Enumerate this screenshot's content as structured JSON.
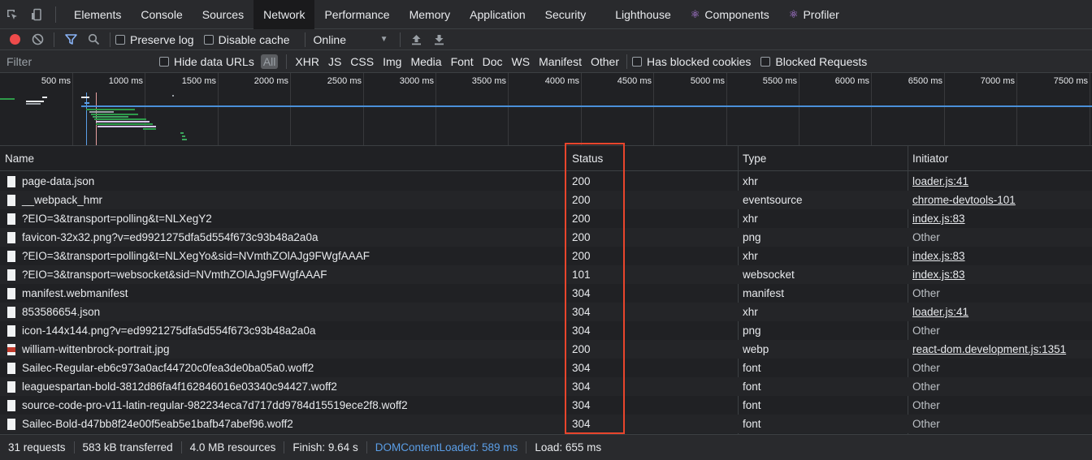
{
  "tabs": [
    "Elements",
    "Console",
    "Sources",
    "Network",
    "Performance",
    "Memory",
    "Application",
    "Security",
    "Lighthouse",
    "Components",
    "Profiler"
  ],
  "toolbar": {
    "preserve_log": "Preserve log",
    "disable_cache": "Disable cache",
    "throttling": "Online"
  },
  "filter": {
    "placeholder": "Filter",
    "hide_data_urls": "Hide data URLs",
    "types": [
      "All",
      "XHR",
      "JS",
      "CSS",
      "Img",
      "Media",
      "Font",
      "Doc",
      "WS",
      "Manifest",
      "Other"
    ],
    "has_blocked_cookies": "Has blocked cookies",
    "blocked_requests": "Blocked Requests"
  },
  "overview": {
    "ticks": [
      "500 ms",
      "1000 ms",
      "1500 ms",
      "2000 ms",
      "2500 ms",
      "3000 ms",
      "3500 ms",
      "4000 ms",
      "4500 ms",
      "5000 ms",
      "5500 ms",
      "6000 ms",
      "6500 ms",
      "7000 ms",
      "7500 ms"
    ]
  },
  "columns": {
    "name": "Name",
    "status": "Status",
    "type": "Type",
    "initiator": "Initiator"
  },
  "requests": [
    {
      "name": "page-data.json",
      "status": "200",
      "type": "xhr",
      "initiator": "loader.js:41",
      "initiator_link": true,
      "icon": "file"
    },
    {
      "name": "__webpack_hmr",
      "status": "200",
      "type": "eventsource",
      "initiator": "chrome-devtools-101",
      "initiator_link": true,
      "icon": "file"
    },
    {
      "name": "?EIO=3&transport=polling&t=NLXegY2",
      "status": "200",
      "type": "xhr",
      "initiator": "index.js:83",
      "initiator_link": true,
      "icon": "file"
    },
    {
      "name": "favicon-32x32.png?v=ed9921275dfa5d554f673c93b48a2a0a",
      "status": "200",
      "type": "png",
      "initiator": "Other",
      "initiator_link": false,
      "icon": "file"
    },
    {
      "name": "?EIO=3&transport=polling&t=NLXegYo&sid=NVmthZOlAJg9FWgfAAAF",
      "status": "200",
      "type": "xhr",
      "initiator": "index.js:83",
      "initiator_link": true,
      "icon": "file"
    },
    {
      "name": "?EIO=3&transport=websocket&sid=NVmthZOlAJg9FWgfAAAF",
      "status": "101",
      "type": "websocket",
      "initiator": "index.js:83",
      "initiator_link": true,
      "icon": "file"
    },
    {
      "name": "manifest.webmanifest",
      "status": "304",
      "type": "manifest",
      "initiator": "Other",
      "initiator_link": false,
      "icon": "file"
    },
    {
      "name": "853586654.json",
      "status": "304",
      "type": "xhr",
      "initiator": "loader.js:41",
      "initiator_link": true,
      "icon": "file"
    },
    {
      "name": "icon-144x144.png?v=ed9921275dfa5d554f673c93b48a2a0a",
      "status": "304",
      "type": "png",
      "initiator": "Other",
      "initiator_link": false,
      "icon": "file"
    },
    {
      "name": "william-wittenbrock-portrait.jpg",
      "status": "200",
      "type": "webp",
      "initiator": "react-dom.development.js:1351",
      "initiator_link": true,
      "icon": "image"
    },
    {
      "name": "Sailec-Regular-eb6c973a0acf44720c0fea3de0ba05a0.woff2",
      "status": "304",
      "type": "font",
      "initiator": "Other",
      "initiator_link": false,
      "icon": "file"
    },
    {
      "name": "leaguespartan-bold-3812d86fa4f162846016e03340c94427.woff2",
      "status": "304",
      "type": "font",
      "initiator": "Other",
      "initiator_link": false,
      "icon": "file"
    },
    {
      "name": "source-code-pro-v11-latin-regular-982234eca7d717dd9784d15519ece2f8.woff2",
      "status": "304",
      "type": "font",
      "initiator": "Other",
      "initiator_link": false,
      "icon": "file"
    },
    {
      "name": "Sailec-Bold-d47bb8f24e00f5eab5e1bafb47abef96.woff2",
      "status": "304",
      "type": "font",
      "initiator": "Other",
      "initiator_link": false,
      "icon": "file"
    }
  ],
  "summary": {
    "requests": "31 requests",
    "transferred": "583 kB transferred",
    "resources": "4.0 MB resources",
    "finish": "Finish: 9.64 s",
    "dom_content_loaded": "DOMContentLoaded: 589 ms",
    "load": "Load: 655 ms"
  },
  "colors": {
    "accent": "#8ab4f8",
    "record": "#ee4b4b",
    "highlight": "#e8452c",
    "dcl": "#5b9fe8"
  }
}
